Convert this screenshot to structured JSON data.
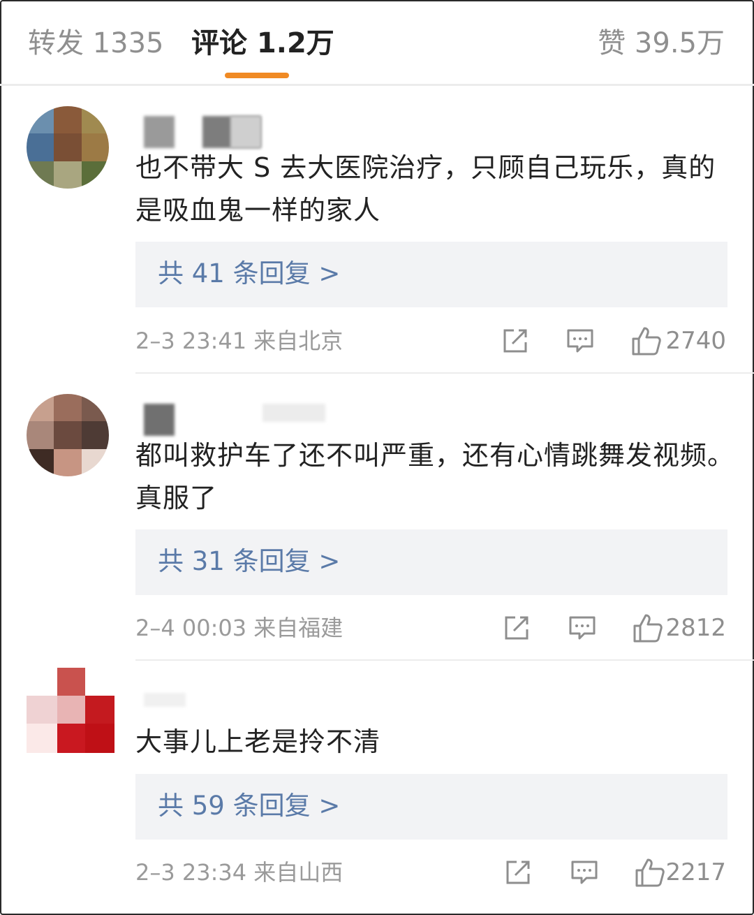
{
  "tabs": {
    "repost": "转发 1335",
    "comment": "评论 1.2万",
    "like": "赞 39.5万"
  },
  "comments": [
    {
      "text": "也不带大 S 去大医院治疗，只顾自己玩乐，真的是吸血鬼一样的家人",
      "replies": "共 41 条回复 >",
      "meta": "2–3 23:41 来自北京",
      "likes": "2740"
    },
    {
      "text": "都叫救护车了还不叫严重，还有心情跳舞发视频。真服了",
      "replies": "共 31 条回复 >",
      "meta": "2–4 00:03 来自福建",
      "likes": "2812"
    },
    {
      "text": "大事儿上老是拎不清",
      "replies": "共 59 条回复 >",
      "meta": "2–3 23:34 来自山西",
      "likes": "2217"
    }
  ],
  "icons": {
    "share": "share-icon",
    "reply": "comment-icon",
    "like": "thumbs-up-icon"
  },
  "colors": {
    "accent": "#f08a24",
    "link": "#5a7aa8",
    "reply_bg": "#f2f3f5"
  }
}
